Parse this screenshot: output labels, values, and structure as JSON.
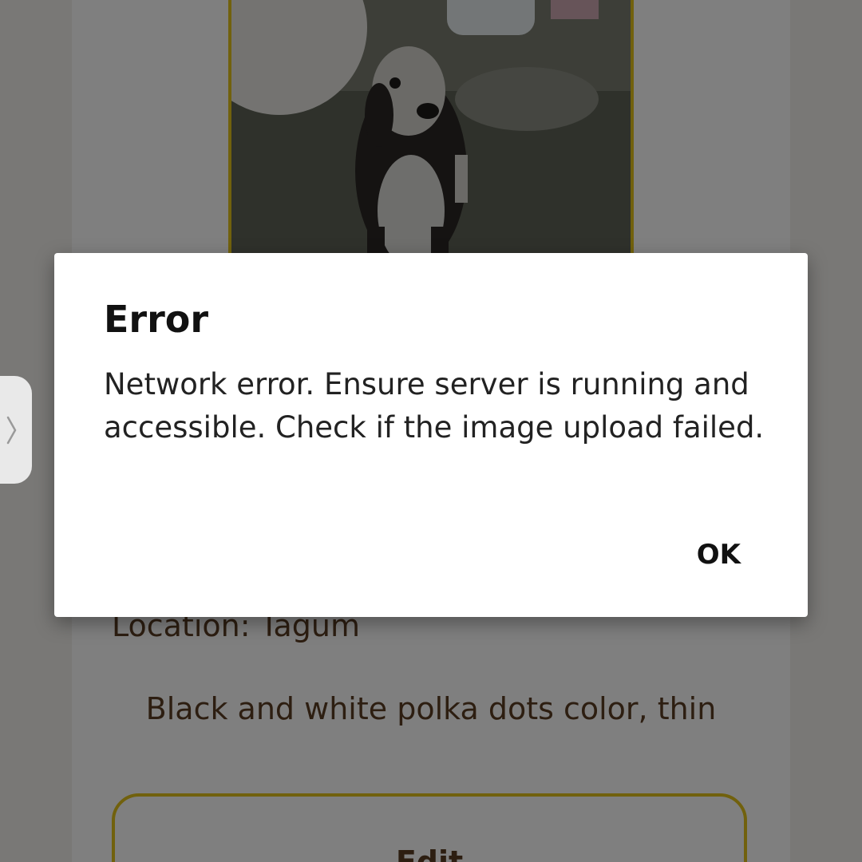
{
  "pet_profile": {
    "photo_alt": "Dog photo",
    "location_text": "Location: Tagum",
    "description": "Black and white polka dots color, thin",
    "edit_label": "Edit"
  },
  "dialog": {
    "title": "Error",
    "message": "Network error. Ensure server is running and accessible. Check if the image upload failed.",
    "ok_label": "OK"
  },
  "colors": {
    "accent_border": "#e3c21a",
    "text_brown": "#5a3d22",
    "scrim": "rgba(0,0,0,0.5)"
  },
  "icons": {
    "edge_handle": "chevron-right-icon"
  }
}
